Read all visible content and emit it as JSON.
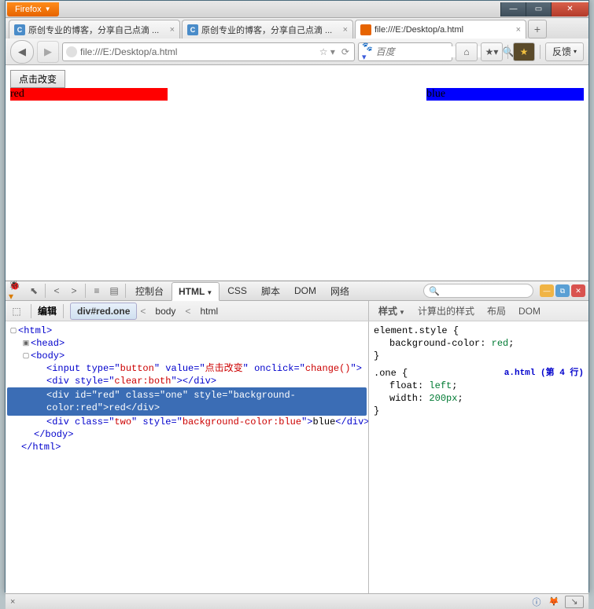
{
  "window": {
    "firefox_label": "Firefox",
    "tabs": [
      {
        "label": "原创专业的博客，分享自己点滴 ...",
        "active": false,
        "favicon": "C"
      },
      {
        "label": "原创专业的博客，分享自己点滴 ...",
        "active": false,
        "favicon": "C"
      },
      {
        "label": "file:///E:/Desktop/a.html",
        "active": true,
        "favicon": ""
      }
    ]
  },
  "nav": {
    "url": "file:///E:/Desktop/a.html",
    "search_placeholder": "百度",
    "feedback_label": "反馈"
  },
  "page": {
    "button_label": "点击改变",
    "red_text": "red",
    "blue_text": "blue"
  },
  "firebug": {
    "tabs": {
      "console": "控制台",
      "html": "HTML",
      "css": "CSS",
      "script": "脚本",
      "dom": "DOM",
      "net": "网络"
    },
    "edit_label": "编辑",
    "breadcrumb": {
      "sel": "div#red.one",
      "parent1": "body",
      "parent2": "html"
    },
    "right_tabs": {
      "style": "样式",
      "computed": "计算出的样式",
      "layout": "布局",
      "dom": "DOM"
    },
    "source": {
      "html_open": "<html>",
      "head": "<head>",
      "body_open": "<body>",
      "input_line_pre": "<input type=\"",
      "input_type": "button",
      "input_mid1": "\" value=\"",
      "input_value": "点击改变",
      "input_mid2": "\" onclick=\"",
      "input_onclick": "change()",
      "input_end": "\">",
      "clear_line": "<div style=\"clear:both\"></div>",
      "clear_pre": "<div style=\"",
      "clear_val": "clear:both",
      "clear_end": "\"></div>",
      "selected": "<div id=\"red\" class=\"one\" style=\"background-color:red\">red</div>",
      "blue_pre": "<div class=\"",
      "blue_class": "two",
      "blue_mid": "\" style=\"",
      "blue_style": "background-color:blue",
      "blue_mid2": "\">",
      "blue_text": "blue",
      "blue_end": "</div>",
      "body_close": "</body>",
      "html_close": "</html>"
    },
    "styles": {
      "element_style": "element.style {",
      "bg_prop": "background-color",
      "bg_val": "red",
      "one_selector": ".one {",
      "one_source": "a.html (第 4 行)",
      "float_prop": "float",
      "float_val": "left",
      "width_prop": "width",
      "width_val": "200px",
      "brace_close": "}"
    }
  },
  "status": {
    "x": "×"
  }
}
